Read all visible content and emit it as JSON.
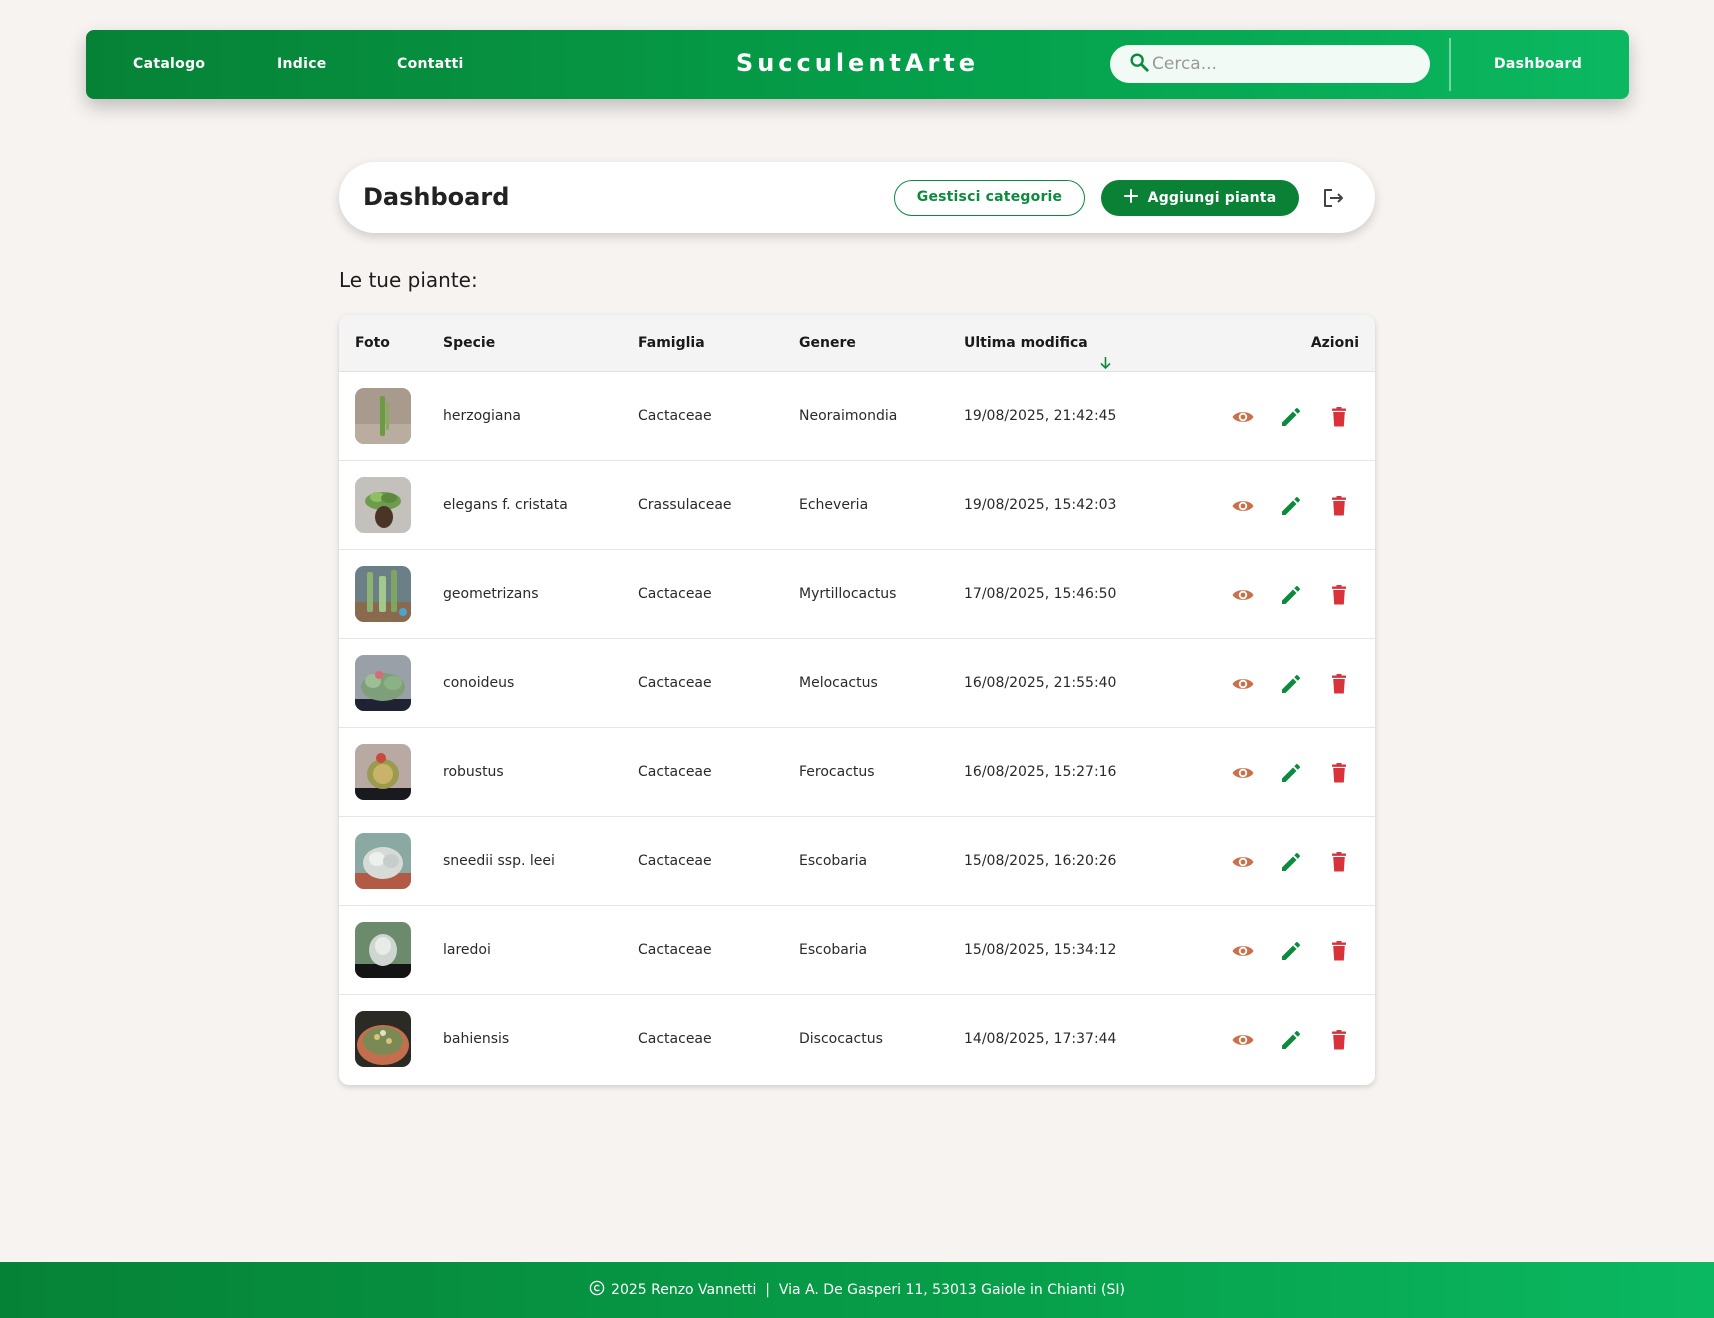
{
  "nav": {
    "links": [
      "Catalogo",
      "Indice",
      "Contatti"
    ],
    "brand": "SucculentArte",
    "search_placeholder": "Cerca...",
    "dashboard_link": "Dashboard"
  },
  "dashboard": {
    "title": "Dashboard",
    "manage_categories_label": "Gestisci categorie",
    "add_plant_label": "Aggiungi pianta",
    "logout_icon": "logout-icon"
  },
  "section_label": "Le tue piante:",
  "table": {
    "headers": {
      "foto": "Foto",
      "specie": "Specie",
      "famiglia": "Famiglia",
      "genere": "Genere",
      "ultima_modifica": "Ultima modifica",
      "azioni": "Azioni"
    },
    "sort": "descending",
    "rows": [
      {
        "specie": "herzogiana",
        "famiglia": "Cactaceae",
        "genere": "Neoraimondia",
        "modifica": "19/08/2025, 21:42:45"
      },
      {
        "specie": "elegans f. cristata",
        "famiglia": "Crassulaceae",
        "genere": "Echeveria",
        "modifica": "19/08/2025, 15:42:03"
      },
      {
        "specie": "geometrizans",
        "famiglia": "Cactaceae",
        "genere": "Myrtillocactus",
        "modifica": "17/08/2025, 15:46:50"
      },
      {
        "specie": "conoideus",
        "famiglia": "Cactaceae",
        "genere": "Melocactus",
        "modifica": "16/08/2025, 21:55:40"
      },
      {
        "specie": "robustus",
        "famiglia": "Cactaceae",
        "genere": "Ferocactus",
        "modifica": "16/08/2025, 15:27:16"
      },
      {
        "specie": "sneedii ssp. leei",
        "famiglia": "Cactaceae",
        "genere": "Escobaria",
        "modifica": "15/08/2025, 16:20:26"
      },
      {
        "specie": "laredoi",
        "famiglia": "Cactaceae",
        "genere": "Escobaria",
        "modifica": "15/08/2025, 15:34:12"
      },
      {
        "specie": "bahiensis",
        "famiglia": "Cactaceae",
        "genere": "Discocactus",
        "modifica": "14/08/2025, 17:37:44"
      }
    ],
    "actions": [
      "eye-icon",
      "pencil-icon",
      "trash-icon"
    ]
  },
  "footer": {
    "text": "2025 Renzo Vannetti  |  Via A. De Gasperi 11, 53013 Gaiole in Chianti (SI)"
  },
  "colors": {
    "brand_green": "#0a8135",
    "header_gradient_end": "#0bb861",
    "view_icon": "#c8714a",
    "edit_icon": "#0c8a3e",
    "delete_icon": "#d8333a",
    "background": "#f6f3f0"
  }
}
